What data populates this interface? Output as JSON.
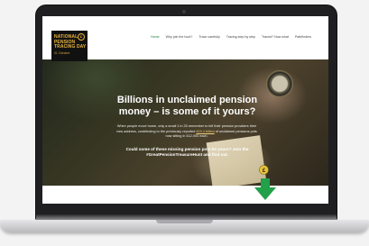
{
  "logo": {
    "line1": "NATIONAL",
    "line2": "PENSION",
    "line3": "TRACING DAY",
    "date": "31 October"
  },
  "nav": {
    "items": [
      {
        "label": "Home",
        "active": true
      },
      {
        "label": "Why join the hunt?",
        "active": false
      },
      {
        "label": "Trace carefully",
        "active": false
      },
      {
        "label": "Tracing step by step",
        "active": false
      },
      {
        "label": "Traced? Now what",
        "active": false
      },
      {
        "label": "Pathfinders",
        "active": false
      }
    ]
  },
  "hero": {
    "headline": "Billions in unclaimed pension money – is some of it yours?",
    "paragraph_before": "When people move home, only a small 1 in 25 remember to tell their pension providers their new address, contributing to the previously reported ",
    "paragraph_link": "£19.4 billion",
    "paragraph_after": " of unclaimed pensions pots now sitting in £12,000 each.",
    "cta": "Could some of these missing pension pots be yours? Join the #GreatPensionTreasureHunt and find out."
  },
  "colors": {
    "accent_green": "#1e7a3e",
    "logo_gold": "#e8b33d",
    "logo_bg": "#111111"
  }
}
